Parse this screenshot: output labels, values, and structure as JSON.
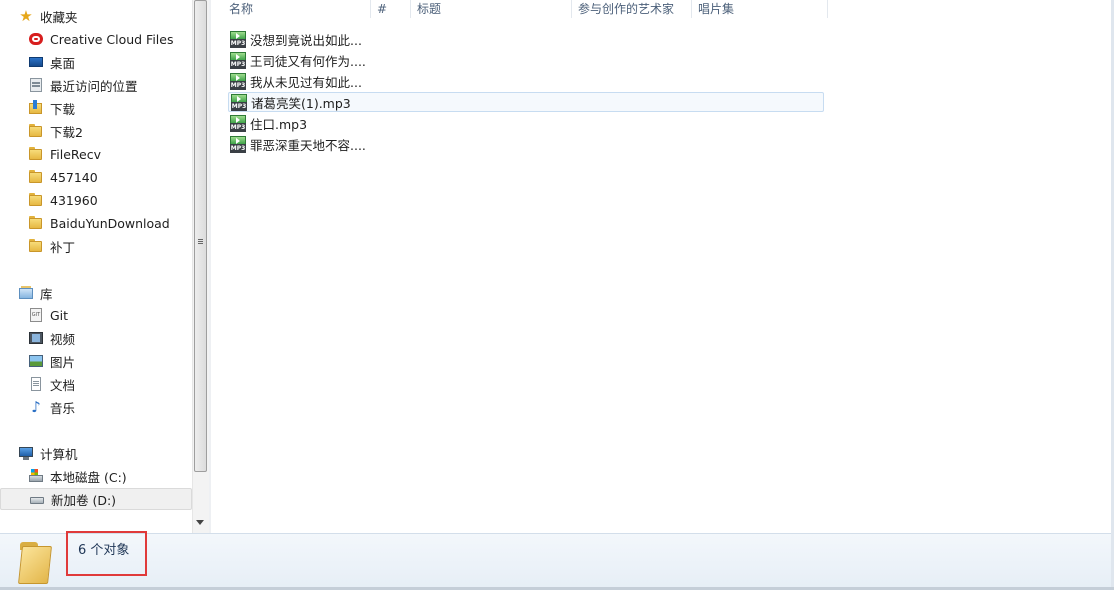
{
  "nav": {
    "favorites": {
      "label": "收藏夹",
      "icon": "star-icon"
    },
    "favorite_items": [
      {
        "label": "Creative Cloud Files",
        "icon": "creative-cloud-icon"
      },
      {
        "label": "桌面",
        "icon": "desktop-icon"
      },
      {
        "label": "最近访问的位置",
        "icon": "recent-places-icon"
      },
      {
        "label": "下载",
        "icon": "downloads-folder-icon"
      },
      {
        "label": "下载2",
        "icon": "folder-icon"
      },
      {
        "label": "FileRecv",
        "icon": "folder-icon"
      },
      {
        "label": "457140",
        "icon": "folder-icon"
      },
      {
        "label": "431960",
        "icon": "folder-icon"
      },
      {
        "label": "BaiduYunDownload",
        "icon": "folder-icon"
      },
      {
        "label": "补丁",
        "icon": "folder-icon"
      }
    ],
    "libraries": {
      "label": "库",
      "icon": "library-icon"
    },
    "library_items": [
      {
        "label": "Git",
        "icon": "git-library-icon"
      },
      {
        "label": "视频",
        "icon": "video-library-icon"
      },
      {
        "label": "图片",
        "icon": "picture-library-icon"
      },
      {
        "label": "文档",
        "icon": "document-library-icon"
      },
      {
        "label": "音乐",
        "icon": "music-library-icon"
      }
    ],
    "computer": {
      "label": "计算机",
      "icon": "computer-icon"
    },
    "computer_items": [
      {
        "label": "本地磁盘 (C:)",
        "icon": "system-drive-icon"
      },
      {
        "label": "新加卷 (D:)",
        "icon": "drive-icon",
        "selected": true
      }
    ]
  },
  "columns": [
    "名称",
    "#",
    "标题",
    "参与创作的艺术家",
    "唱片集"
  ],
  "files": [
    {
      "name": "没想到竟说出如此...",
      "icon": "mp3-file-icon"
    },
    {
      "name": "王司徒又有何作为....",
      "icon": "mp3-file-icon"
    },
    {
      "name": "我从未见过有如此...",
      "icon": "mp3-file-icon"
    },
    {
      "name": "诸葛亮笑(1).mp3",
      "icon": "mp3-file-icon",
      "selected": true
    },
    {
      "name": "住口.mp3",
      "icon": "mp3-file-icon"
    },
    {
      "name": "罪恶深重天地不容....",
      "icon": "mp3-file-icon"
    }
  ],
  "mp3_badge": "MP3",
  "status": {
    "text": "6 个对象",
    "icon": "folder-icon"
  },
  "colors": {
    "highlight_box": "#e03a3a",
    "selection_bg": "#f5f9fd",
    "status_bg": "#eaf1f8"
  }
}
